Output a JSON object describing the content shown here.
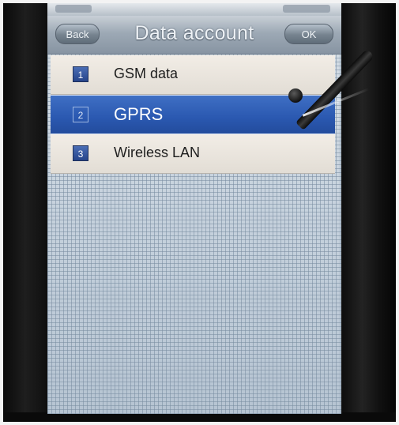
{
  "title": "Data account",
  "back_label": "Back",
  "ok_label": "OK",
  "items": [
    {
      "number": "1",
      "label": "GSM data",
      "selected": false
    },
    {
      "number": "2",
      "label": "GPRS",
      "selected": true
    },
    {
      "number": "3",
      "label": "Wireless LAN",
      "selected": false
    }
  ],
  "colors": {
    "selected_row": "#2a58b0",
    "row_background": "#e9e4dd",
    "titlebar": "#9da9b5"
  }
}
